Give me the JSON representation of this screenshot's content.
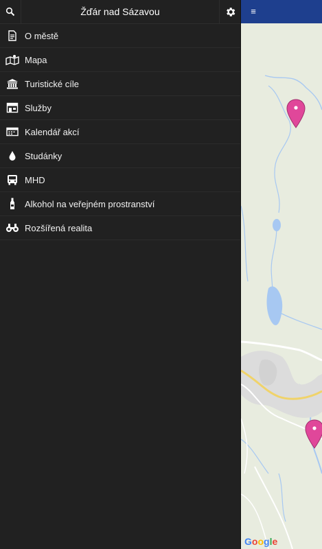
{
  "header": {
    "title": "Žďár nad Sázavou"
  },
  "menu": [
    {
      "label": "O městě",
      "icon": "document-icon"
    },
    {
      "label": "Mapa",
      "icon": "map-icon"
    },
    {
      "label": "Turistické cíle",
      "icon": "museum-icon"
    },
    {
      "label": "Služby",
      "icon": "shop-icon"
    },
    {
      "label": "Kalendář akcí",
      "icon": "calendar-icon"
    },
    {
      "label": "Studánky",
      "icon": "water-drop-icon"
    },
    {
      "label": "MHD",
      "icon": "bus-icon"
    },
    {
      "label": "Alkohol na veřejném prostranství",
      "icon": "bottle-icon"
    },
    {
      "label": "Rozšířená realita",
      "icon": "binoculars-icon"
    }
  ],
  "map": {
    "attribution": "Google",
    "header_color": "#1e3f8e",
    "marker_color": "#e0479a",
    "water_color": "#a7c8f2"
  }
}
